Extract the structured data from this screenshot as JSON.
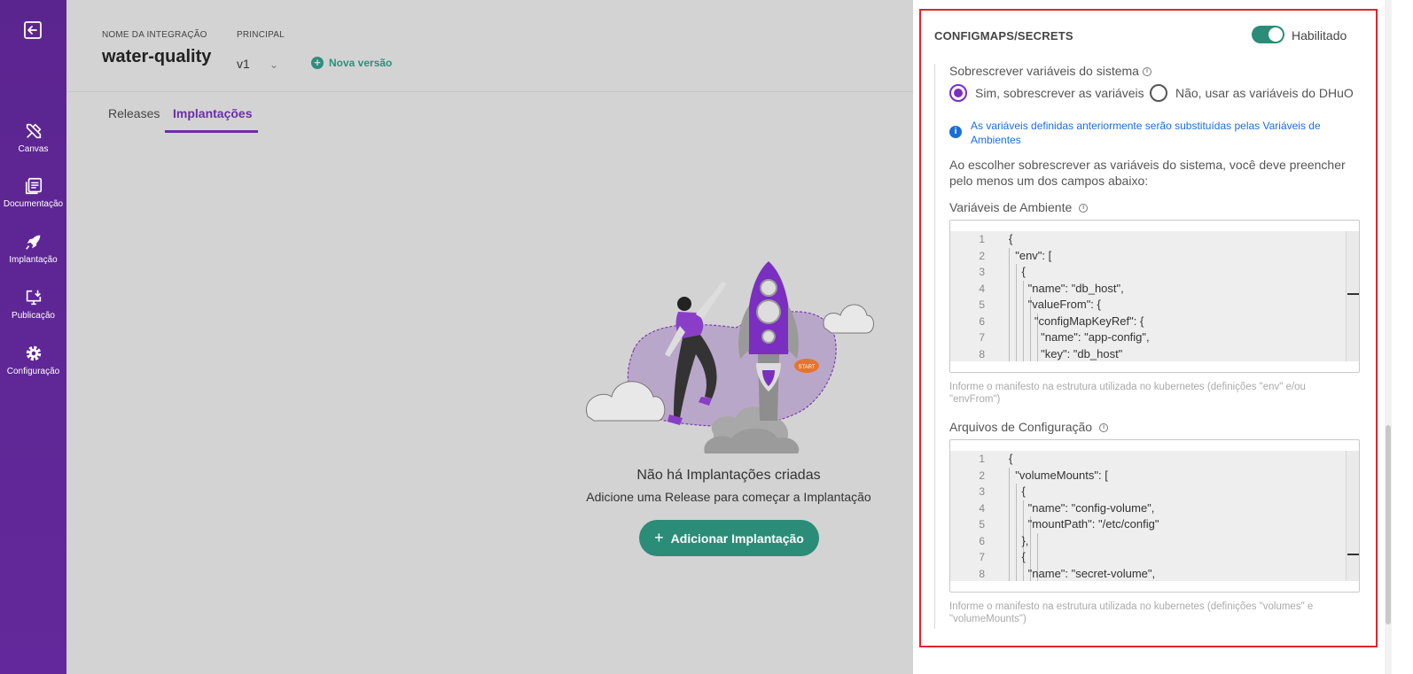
{
  "sidebar": {
    "items": [
      {
        "label": "Canvas",
        "icon": "canvas-tools-icon"
      },
      {
        "label": "Documentação",
        "icon": "documentation-icon"
      },
      {
        "label": "Implantação",
        "icon": "rocket-icon"
      },
      {
        "label": "Publicação",
        "icon": "publish-icon"
      },
      {
        "label": "Configuração",
        "icon": "gear-icon"
      }
    ]
  },
  "header": {
    "integration_label": "NOME DA INTEGRAÇÃO",
    "integration_name": "water-quality",
    "principal_label": "PRINCIPAL",
    "version": "v1",
    "new_version": "Nova versão"
  },
  "tabs": [
    {
      "label": "Releases",
      "active": false
    },
    {
      "label": "Implantações",
      "active": true
    }
  ],
  "empty_state": {
    "title": "Não há Implantações criadas",
    "subtitle": "Adicione uma Release para começar a Implantação",
    "button": "Adicionar Implantação"
  },
  "panel": {
    "title": "CONFIGMAPS/SECRETS",
    "toggle_label": "Habilitado",
    "toggle_on": true,
    "override_label": "Sobrescrever variáveis do sistema",
    "radio_yes": "Sim, sobrescrever as variáveis",
    "radio_no": "Não, usar as variáveis do DHuO",
    "info_text": "As variáveis definidas anteriormente serão substituídas pelas Variáveis de Ambientes",
    "description": "Ao escolher sobrescrever as variáveis do sistema, você deve preencher pelo menos um dos campos abaixo:",
    "env_label": "Variáveis de Ambiente",
    "env_code": [
      "{",
      "  \"env\": [",
      "    {",
      "      \"name\": \"db_host\",",
      "      \"valueFrom\": {",
      "        \"configMapKeyRef\": {",
      "          \"name\": \"app-config\",",
      "          \"key\": \"db_host\""
    ],
    "env_hint": "Informe o manifesto na estrutura utilizada no kubernetes (definições \"env\" e/ou \"envFrom\")",
    "config_label": "Arquivos de Configuração",
    "config_code": [
      "{",
      "  \"volumeMounts\": [",
      "    {",
      "      \"name\": \"config-volume\",",
      "      \"mountPath\": \"/etc/config\"",
      "    },",
      "    {",
      "      \"name\": \"secret-volume\","
    ],
    "config_hint": "Informe o manifesto na estrutura utilizada no kubernetes (definições \"volumes\" e \"volumeMounts\")",
    "colors": {
      "accent": "#2b8c78",
      "purple": "#7a2fc0",
      "info": "#1a6fd6",
      "highlight": "#e3242b"
    }
  }
}
